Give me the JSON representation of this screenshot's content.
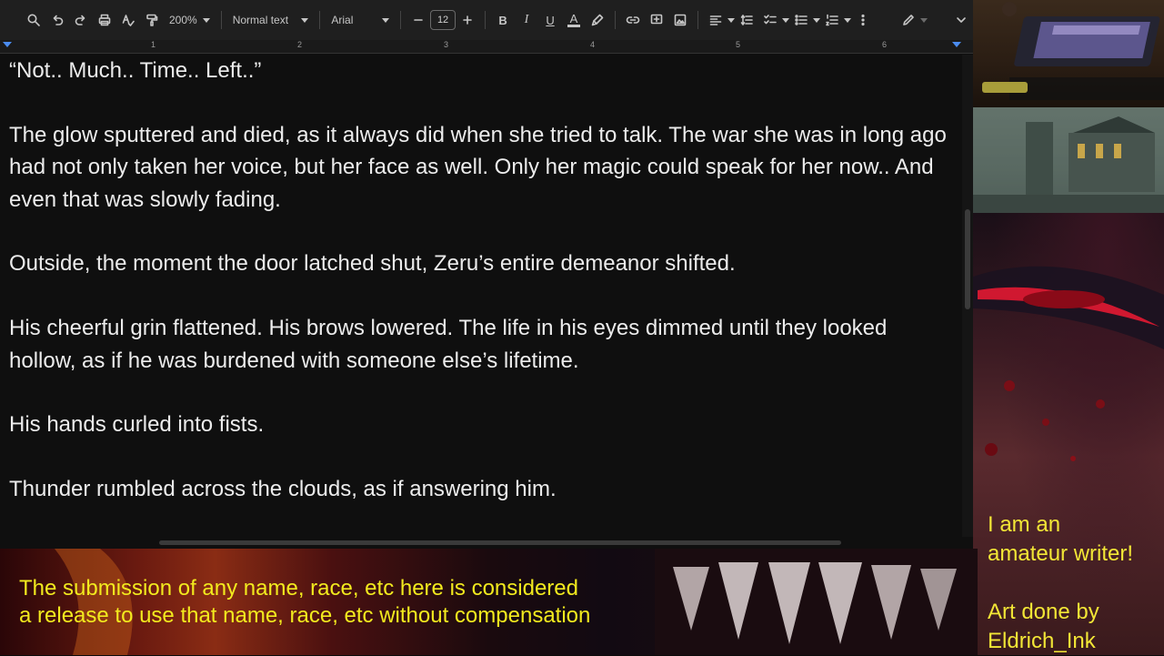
{
  "toolbar": {
    "zoom": "200%",
    "style": "Normal text",
    "font": "Arial",
    "font_size": "12",
    "bold": "B",
    "italic": "I",
    "underline": "U",
    "text_color": "A"
  },
  "ruler": {
    "numbers": [
      "1",
      "2",
      "3",
      "4",
      "5",
      "6"
    ]
  },
  "document": {
    "paragraphs": [
      "“Not.. Much.. Time.. Left..”",
      "The glow sputtered and died, as it always did when she tried to talk. The war she was in long ago had not only taken her voice, but her face as well. Only her magic could speak for her now.. And even that was slowly fading.",
      "Outside, the moment the door latched shut, Zeru’s entire demeanor shifted.",
      "His cheerful grin flattened. His brows lowered. The life in his eyes dimmed until they looked hollow, as if he was burdened with someone else’s lifetime.",
      "His hands curled into fists.",
      "Thunder rumbled across the clouds, as if answering him."
    ]
  },
  "overlay": {
    "disclaimer_line1": "The submission of any name, race, etc here is considered",
    "disclaimer_line2": "a release to use that name, race, etc without compensation",
    "note_line1": "I am an",
    "note_line2": "amateur writer!",
    "note_line3": "Art done by",
    "note_line4": "Eldrich_Ink"
  },
  "colors": {
    "overlay_text": "#f2ea1e",
    "doc_background": "#0f0f0f",
    "doc_text": "#ececec",
    "toolbar_background": "#1f1f1f",
    "ruler_marker": "#4b8cf0"
  }
}
